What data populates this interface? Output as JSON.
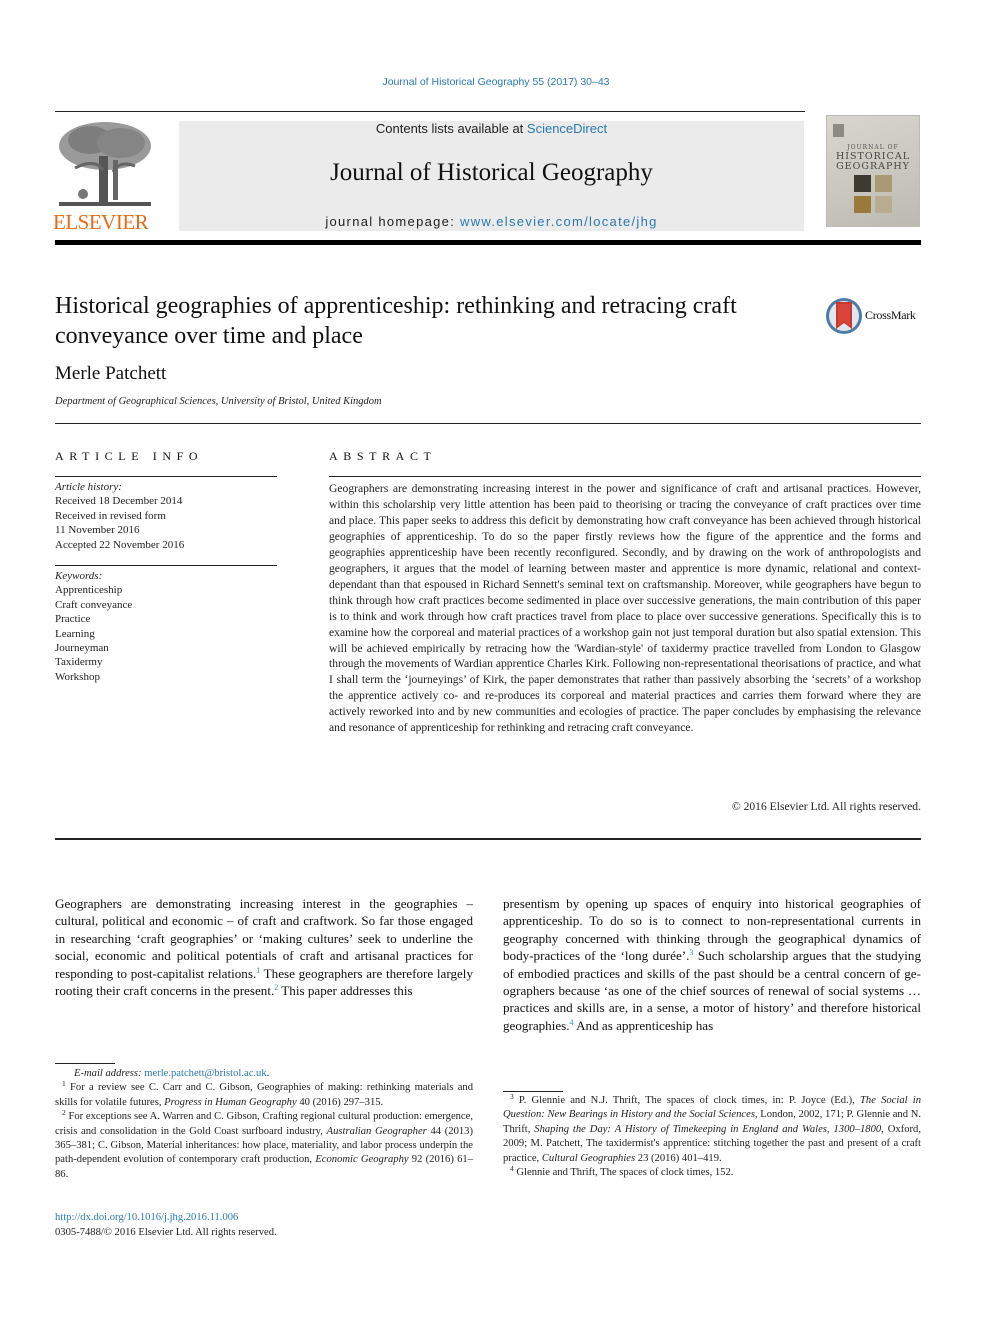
{
  "header": {
    "citation": "Journal of Historical Geography 55 (2017) 30–43",
    "contents_prefix": "Contents lists available at ",
    "contents_link": "ScienceDirect",
    "journal_title": "Journal of Historical Geography",
    "homepage_prefix": "journal homepage: ",
    "homepage_link": "www.elsevier.com/locate/jhg",
    "publisher_logo_text": "ELSEVIER",
    "cover": {
      "line1": "JOURNAL OF",
      "line2": "HISTORICAL",
      "line3": "GEOGRAPHY"
    },
    "colors": {
      "link": "#2a7ab0",
      "elsevier_orange": "#e96b18",
      "header_box": "#ebebeb"
    }
  },
  "article": {
    "title": "Historical geographies of apprenticeship: rethinking and retracing craft conveyance over time and place",
    "crossmark_label": "CrossMark",
    "author": "Merle Patchett",
    "affiliation": "Department of Geographical Sciences, University of Bristol, United Kingdom"
  },
  "article_info": {
    "heading": "ARTICLE INFO",
    "history_label": "Article history:",
    "history": [
      "Received 18 December 2014",
      "Received in revised form",
      "11 November 2016",
      "Accepted 22 November 2016"
    ],
    "keywords_label": "Keywords:",
    "keywords": [
      "Apprenticeship",
      "Craft conveyance",
      "Practice",
      "Learning",
      "Journeyman",
      "Taxidermy",
      "Workshop"
    ]
  },
  "abstract": {
    "heading": "ABSTRACT",
    "text": "Geographers are demonstrating increasing interest in the power and significance of craft and artisanal practices. However, within this scholarship very little attention has been paid to theorising or tracing the conveyance of craft practices over time and place. This paper seeks to address this deficit by demon­strating how craft conveyance has been achieved through historical geographies of apprenticeship. To do so the paper firstly reviews how the figure of the apprentice and the forms and geographies appren­ticeship have been recently reconfigured. Secondly, and by drawing on the work of anthropologists and geographers, it argues that the model of learning between master and apprentice is more dynamic, relational and context-dependant than that espoused in Richard Sennett's seminal text on craftsmanship. Moreover, while geographers have begun to think through how craft practices become sedimented in place over successive generations, the main contribution of this paper is to think and work through how craft practices travel from place to place over successive generations. Specifically this is to examine how the corporeal and material practices of a workshop gain not just temporal duration but also spatial extension. This will be achieved empirically by retracing how the 'Wardian-style' of taxidermy practice travelled from London to Glasgow through the movements of Wardian apprentice Charles Kirk. Following non-representational theorisations of practice, and what I shall term the ‘journeyings’ of Kirk, the paper demonstrates that rather than passively absorbing the ‘secrets’ of a workshop the apprentice actively co- and re-produces its corporeal and material practices and carries them forward where they are actively reworked into and by new communities and ecologies of practice. The paper concludes by emphasising the relevance and resonance of apprenticeship for rethinking and retracing craft conveyance.",
    "copyright": "© 2016 Elsevier Ltd. All rights reserved."
  },
  "body": {
    "left": [
      "Geographers are demonstrating increasing interest in the geogra­phies – cultural, political and economic – of craft and craftwork. So far those engaged in researching ‘craft geographies’ or ‘making cultures’ seek to underline the social, economic and political po­tentials of craft and artisanal practices for responding to post-capitalist relations.",
      "1",
      " These geographers are therefore largely root­ing their craft concerns in the present.",
      "2",
      " This paper addresses this"
    ],
    "right": [
      "presentism by opening up spaces of enquiry into historical geog­raphies of apprenticeship. To do so is to connect to non-representational currents in geography concerned with thinking through the geographical dynamics of body-practices of the ‘long durée’.",
      "3",
      " Such scholarship argues that the studying of embodied practices and skills of the past should be a central concern of ge­ographers because ‘as one of the chief sources of renewal of social systems … practices and skills are, in a sense, a motor of history’ and therefore historical geographies.",
      "4",
      " And as apprenticeship has"
    ]
  },
  "footnotes": {
    "email_label": "E-mail address: ",
    "email": "merle.patchett@bristol.ac.uk",
    "fn1": {
      "num": "1",
      "a": " For a review see C. Carr and C. Gibson, Geographies of making: rethinking materials and skills for volatile futures, ",
      "b": "Progress in Human Geography",
      "c": " 40 (2016) 297–315."
    },
    "fn2": {
      "num": "2",
      "a": " For exceptions see A. Warren and C. Gibson, Crafting regional cultural pro­duction: emergence, crisis and consolidation in the Gold Coast surfboard industry, ",
      "b": "Australian Geographer",
      "c": " 44 (2013) 365–381; C. Gibson, Material inheritances: how place, materiality, and labor process underpin the path-dependent evolution of contemporary craft production, ",
      "d": "Economic Geography",
      "e": " 92 (2016) 61–86."
    },
    "fn3": {
      "num": "3",
      "a": " P. Glennie and N.J. Thrift, The spaces of clock times, in: P. Joyce (Ed.), ",
      "b": "The Social in Question: New Bearings in History and the Social Sciences",
      "c": ", London, 2002, 171; P. Glennie and N. Thrift, ",
      "d": "Shaping the Day: A History of Timekeeping in England and Wales, 1300–1800",
      "e": ", Oxford, 2009; M. Patchett, The taxidermist's apprentice: stitching together the past and present of a craft practice, ",
      "f": "Cultural Geographies",
      "g": " 23 (2016) 401–419."
    },
    "fn4": {
      "num": "4",
      "a": " Glennie and Thrift, The spaces of clock times, 152."
    }
  },
  "doi": {
    "link": "http://dx.doi.org/10.1016/j.jhg.2016.11.006",
    "issn_line": "0305-7488/© 2016 Elsevier Ltd. All rights reserved."
  }
}
